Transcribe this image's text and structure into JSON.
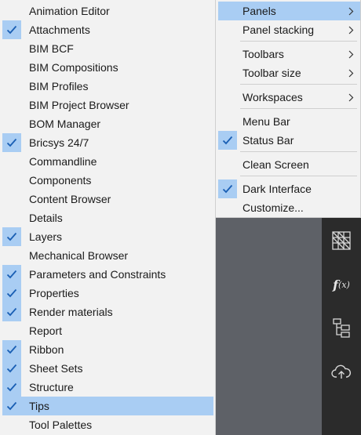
{
  "left_menu": {
    "items": [
      {
        "label": "Animation Editor",
        "checked": false
      },
      {
        "label": "Attachments",
        "checked": true
      },
      {
        "label": "BIM BCF",
        "checked": false
      },
      {
        "label": "BIM Compositions",
        "checked": false
      },
      {
        "label": "BIM Profiles",
        "checked": false
      },
      {
        "label": "BIM Project Browser",
        "checked": false
      },
      {
        "label": "BOM Manager",
        "checked": false
      },
      {
        "label": "Bricsys 24/7",
        "checked": true
      },
      {
        "label": "Commandline",
        "checked": false
      },
      {
        "label": "Components",
        "checked": false
      },
      {
        "label": "Content Browser",
        "checked": false
      },
      {
        "label": "Details",
        "checked": false
      },
      {
        "label": "Layers",
        "checked": true
      },
      {
        "label": "Mechanical Browser",
        "checked": false
      },
      {
        "label": "Parameters and Constraints",
        "checked": true
      },
      {
        "label": "Properties",
        "checked": true
      },
      {
        "label": "Render materials",
        "checked": true
      },
      {
        "label": "Report",
        "checked": false
      },
      {
        "label": "Ribbon",
        "checked": true
      },
      {
        "label": "Sheet Sets",
        "checked": true
      },
      {
        "label": "Structure",
        "checked": true
      },
      {
        "label": "Tips",
        "checked": true
      },
      {
        "label": "Tool Palettes",
        "checked": false
      }
    ]
  },
  "right_menu": {
    "items": [
      {
        "label": "Panels",
        "checked": false,
        "submenu": true
      },
      {
        "label": "Panel stacking",
        "checked": false,
        "submenu": true
      },
      {
        "label": "Toolbars",
        "checked": false,
        "submenu": true
      },
      {
        "label": "Toolbar size",
        "checked": false,
        "submenu": true
      },
      {
        "label": "Workspaces",
        "checked": false,
        "submenu": true
      },
      {
        "label": "Menu Bar",
        "checked": false,
        "submenu": false
      },
      {
        "label": "Status Bar",
        "checked": true,
        "submenu": false
      },
      {
        "label": "Clean Screen",
        "checked": false,
        "submenu": false
      },
      {
        "label": "Dark Interface",
        "checked": true,
        "submenu": false
      },
      {
        "label": "Customize...",
        "checked": false,
        "submenu": false
      }
    ]
  },
  "side_toolbar": {
    "icons": [
      "hatch-grid-icon",
      "function-icon",
      "structure-tree-icon",
      "cloud-upload-icon"
    ],
    "function_label": "f",
    "function_sub": "(x)"
  },
  "colors": {
    "menu_bg": "#f2f2f2",
    "highlight": "#a9cdf3",
    "check": "#1a5fb4",
    "strip_bg": "#2b2b2b",
    "canvas_bg": "#5e6167"
  }
}
